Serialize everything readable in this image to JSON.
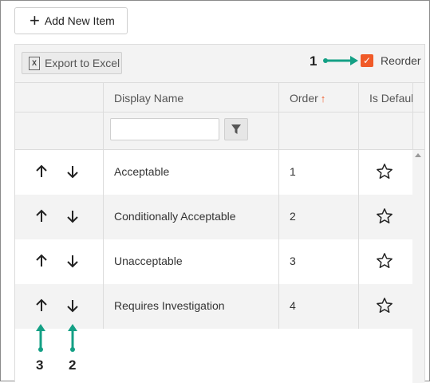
{
  "toolbar": {
    "add_label": "Add New Item",
    "export_label": "Export to Excel",
    "reorder_label": "Reorder",
    "reorder_checked": true
  },
  "columns": {
    "display_name": "Display Name",
    "order": "Order",
    "is_default": "Is Defaul"
  },
  "filter": {
    "value": "",
    "placeholder": ""
  },
  "rows": [
    {
      "name": "Acceptable",
      "order": "1"
    },
    {
      "name": "Conditionally Acceptable",
      "order": "2"
    },
    {
      "name": "Unacceptable",
      "order": "3"
    },
    {
      "name": "Requires Investigation",
      "order": "4"
    }
  ],
  "callouts": {
    "one": "1",
    "two": "2",
    "three": "3"
  },
  "colors": {
    "accent": "#f05a28",
    "callout": "#14a085",
    "header_bg": "#f3f3f3"
  },
  "icons": [
    "plus-icon",
    "excel-icon",
    "filter-icon",
    "arrow-up-icon",
    "arrow-down-icon",
    "star-icon"
  ]
}
